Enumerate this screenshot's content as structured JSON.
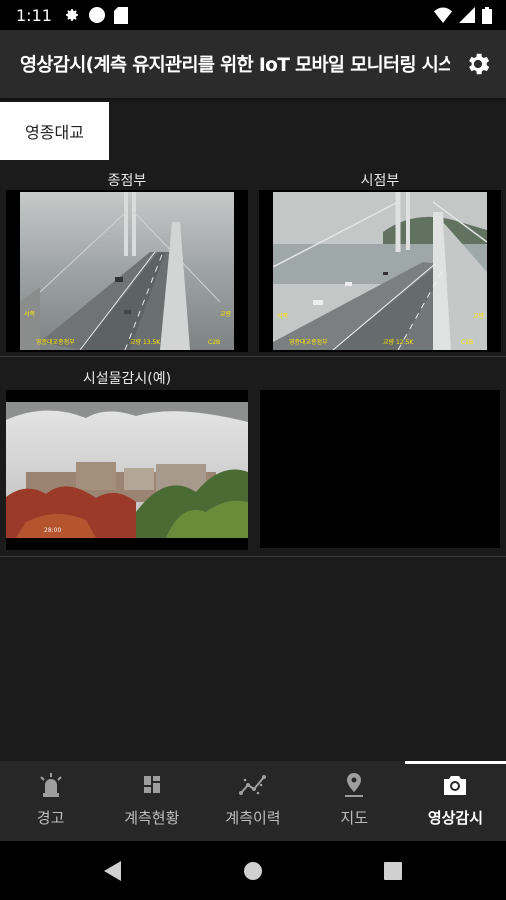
{
  "status": {
    "time": "1:11"
  },
  "appbar": {
    "title": "영상감시(계측 유지관리를 위한 IoT 모바일 모니터링 시스템)"
  },
  "tabs": [
    {
      "label": "영종대교",
      "selected": true
    }
  ],
  "cameras": [
    {
      "label": "종점부",
      "overlay_left": "영종대교종점부",
      "overlay_mid": "교량 13.5K",
      "overlay_right": "C2B",
      "corner_tl": "서쪽",
      "corner_tr": "교량"
    },
    {
      "label": "시점부",
      "overlay_left": "영종대교종점부",
      "overlay_mid": "교량 12.5K",
      "overlay_right": "C2B",
      "corner_tl": "서쪽",
      "corner_tr": "교량"
    },
    {
      "label": "시설물감시(예)",
      "overlay_left": "28:00"
    }
  ],
  "bottom_nav": [
    {
      "label": "경고",
      "icon": "alarm-light-icon",
      "active": false
    },
    {
      "label": "계측현황",
      "icon": "dashboard-grid-icon",
      "active": false
    },
    {
      "label": "계측이력",
      "icon": "chart-line-icon",
      "active": false
    },
    {
      "label": "지도",
      "icon": "map-pin-icon",
      "active": false
    },
    {
      "label": "영상감시",
      "icon": "camera-icon",
      "active": true
    }
  ],
  "colors": {
    "background": "#1b1b1b",
    "appbar": "#2b2b2b",
    "navbar": "#272727",
    "tab_selected_bg": "#ffffff"
  }
}
